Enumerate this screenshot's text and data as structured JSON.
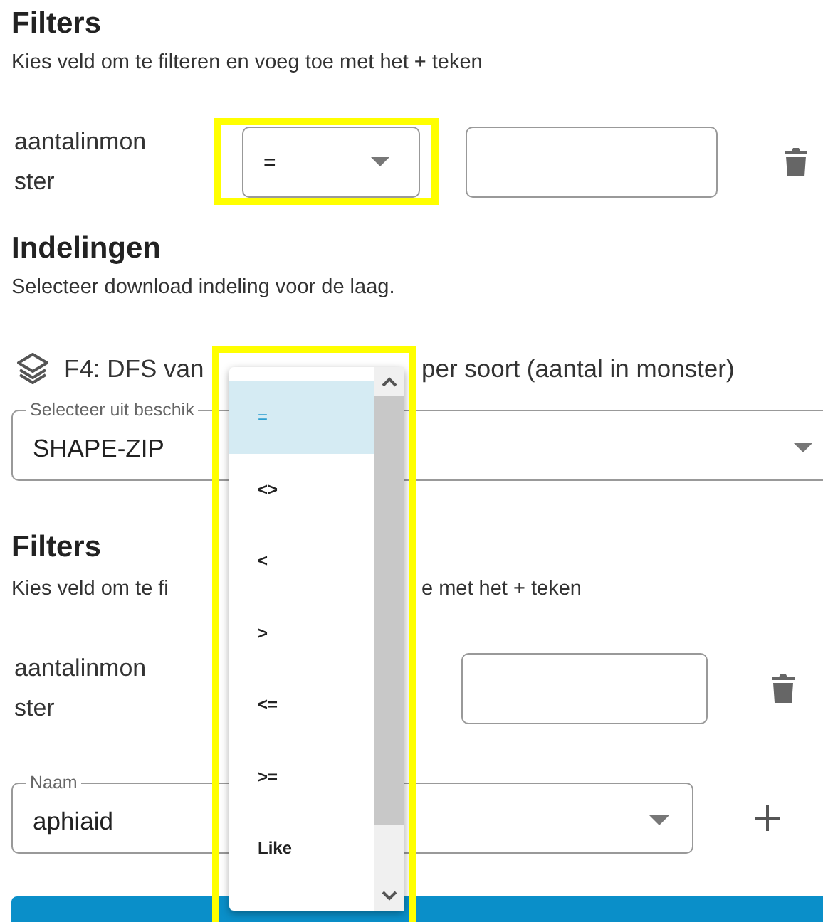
{
  "filters": {
    "title": "Filters",
    "hint": "Kies veld om te filteren en voeg toe met het + teken",
    "row": {
      "field": "aantalinmonster",
      "operator": "="
    }
  },
  "formats": {
    "title": "Indelingen",
    "hint": "Selecteer download indeling voor de laag.",
    "layer": {
      "title_parts": [
        "F4: DFS van",
        "per soort (aantal in monster)"
      ],
      "format_select": {
        "label": "Selecteer uit beschik",
        "value": "SHAPE-ZIP"
      },
      "filters": {
        "title": "Filters",
        "hint_parts": [
          "Kies veld om te fi",
          "e met het + teken"
        ],
        "row": {
          "field": "aantalinmonster"
        },
        "name_select": {
          "label": "Naam",
          "value": "aphiaid"
        }
      }
    }
  },
  "operator_menu": {
    "options": [
      {
        "label": "=",
        "selected": true
      },
      {
        "label": "<>",
        "selected": false
      },
      {
        "label": "<",
        "selected": false
      },
      {
        "label": ">",
        "selected": false
      },
      {
        "label": "<=",
        "selected": false
      },
      {
        "label": ">=",
        "selected": false
      },
      {
        "label": "Like",
        "selected": false
      }
    ]
  }
}
